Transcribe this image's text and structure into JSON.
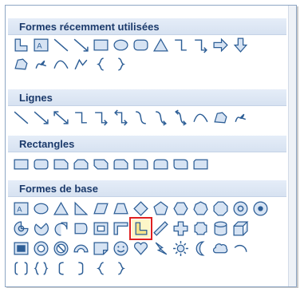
{
  "sections": [
    {
      "title": "Formes récemment utilisées"
    },
    {
      "title": "Lignes"
    },
    {
      "title": "Rectangles"
    },
    {
      "title": "Formes de base"
    }
  ],
  "selected_shape": "corner-shape"
}
